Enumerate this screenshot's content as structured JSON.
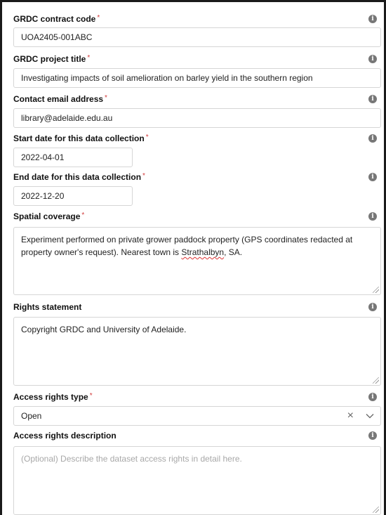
{
  "fields": {
    "contract_code": {
      "label": "GRDC contract code",
      "required": "*",
      "value": "UOA2405-001ABC"
    },
    "project_title": {
      "label": "GRDC project title",
      "required": "*",
      "value": "Investigating impacts of soil amelioration on barley yield in the southern region"
    },
    "contact_email": {
      "label": "Contact email address",
      "required": "*",
      "value": "library@adelaide.edu.au"
    },
    "start_date": {
      "label": "Start date for this data collection",
      "required": "*",
      "value": "2022-04-01"
    },
    "end_date": {
      "label": "End date for this data collection",
      "required": "*",
      "value": "2022-12-20"
    },
    "spatial_coverage": {
      "label": "Spatial coverage",
      "required": "*",
      "value_part1": "Experiment performed on private grower paddock property (GPS coordinates redacted at property owner's request). Nearest town is ",
      "value_misspelled": "Strathalbyn",
      "value_part2": ", SA."
    },
    "rights_statement": {
      "label": "Rights statement",
      "value": "Copyright GRDC and University of Adelaide."
    },
    "access_rights_type": {
      "label": "Access rights type",
      "required": "*",
      "value": "Open"
    },
    "access_rights_description": {
      "label": "Access rights description",
      "placeholder": "(Optional) Describe the dataset access rights in detail here."
    }
  },
  "icons": {
    "info": "info-icon",
    "clear": "clear-icon",
    "chevron": "chevron-down-icon",
    "resize": "resize-handle-icon"
  },
  "info_glyph": "i",
  "clear_glyph": "×"
}
